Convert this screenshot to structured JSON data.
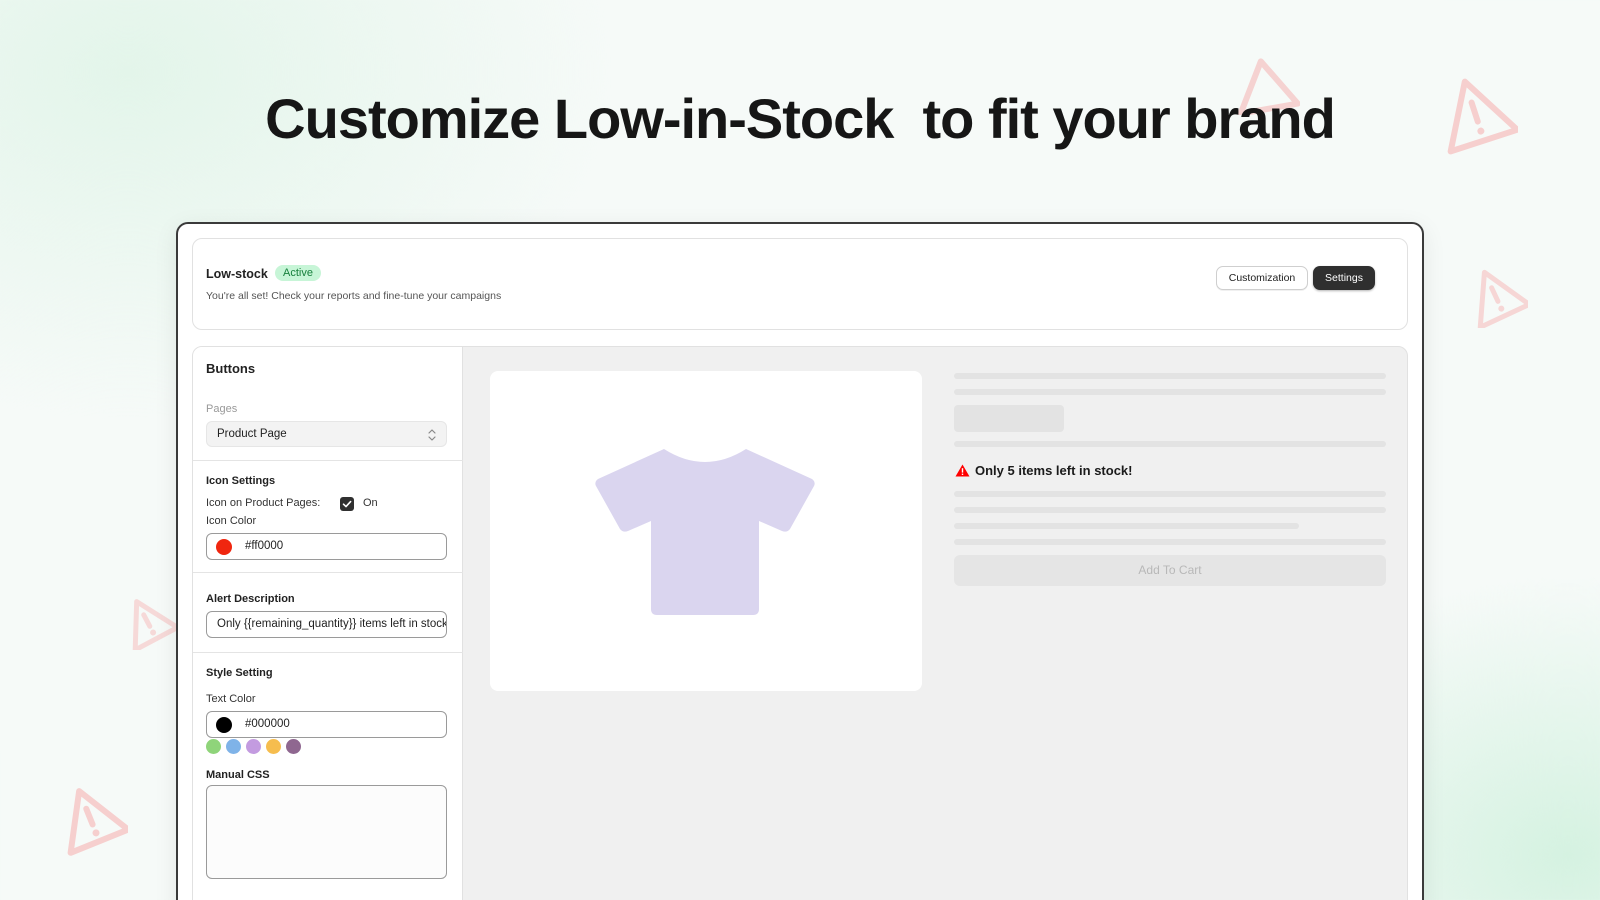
{
  "headline": "Customize Low-in-Stock  to fit your brand",
  "header": {
    "title": "Low-stock",
    "badge": "Active",
    "subtitle": "You're all set! Check your reports and fine-tune your campaigns",
    "customization_label": "Customization",
    "settings_label": "Settings"
  },
  "panel": {
    "title": "Buttons",
    "pages_label": "Pages",
    "pages_value": "Product Page",
    "icon_settings_title": "Icon Settings",
    "icon_on_pages_label": "Icon on Product Pages:",
    "icon_on_pages_checked": true,
    "icon_on_pages_state": "On",
    "icon_color_label": "Icon Color",
    "icon_color_value": "#ff0000",
    "alert_desc_title": "Alert Description",
    "alert_desc_value": "Only {{remaining_quantity}} items left in stock!",
    "style_title": "Style Setting",
    "text_color_label": "Text Color",
    "text_color_value": "#000000",
    "swatches": [
      "#8fd47a",
      "#7fb3e8",
      "#c39be0",
      "#f6bd4e",
      "#8f6790"
    ],
    "manual_css_label": "Manual CSS",
    "manual_css_value": ""
  },
  "preview": {
    "stock_message": "Only 5 items left in stock!",
    "add_to_cart": "Add To Cart",
    "shirt_color": "#dad5ef",
    "alert_icon_color": "#ff0000"
  }
}
